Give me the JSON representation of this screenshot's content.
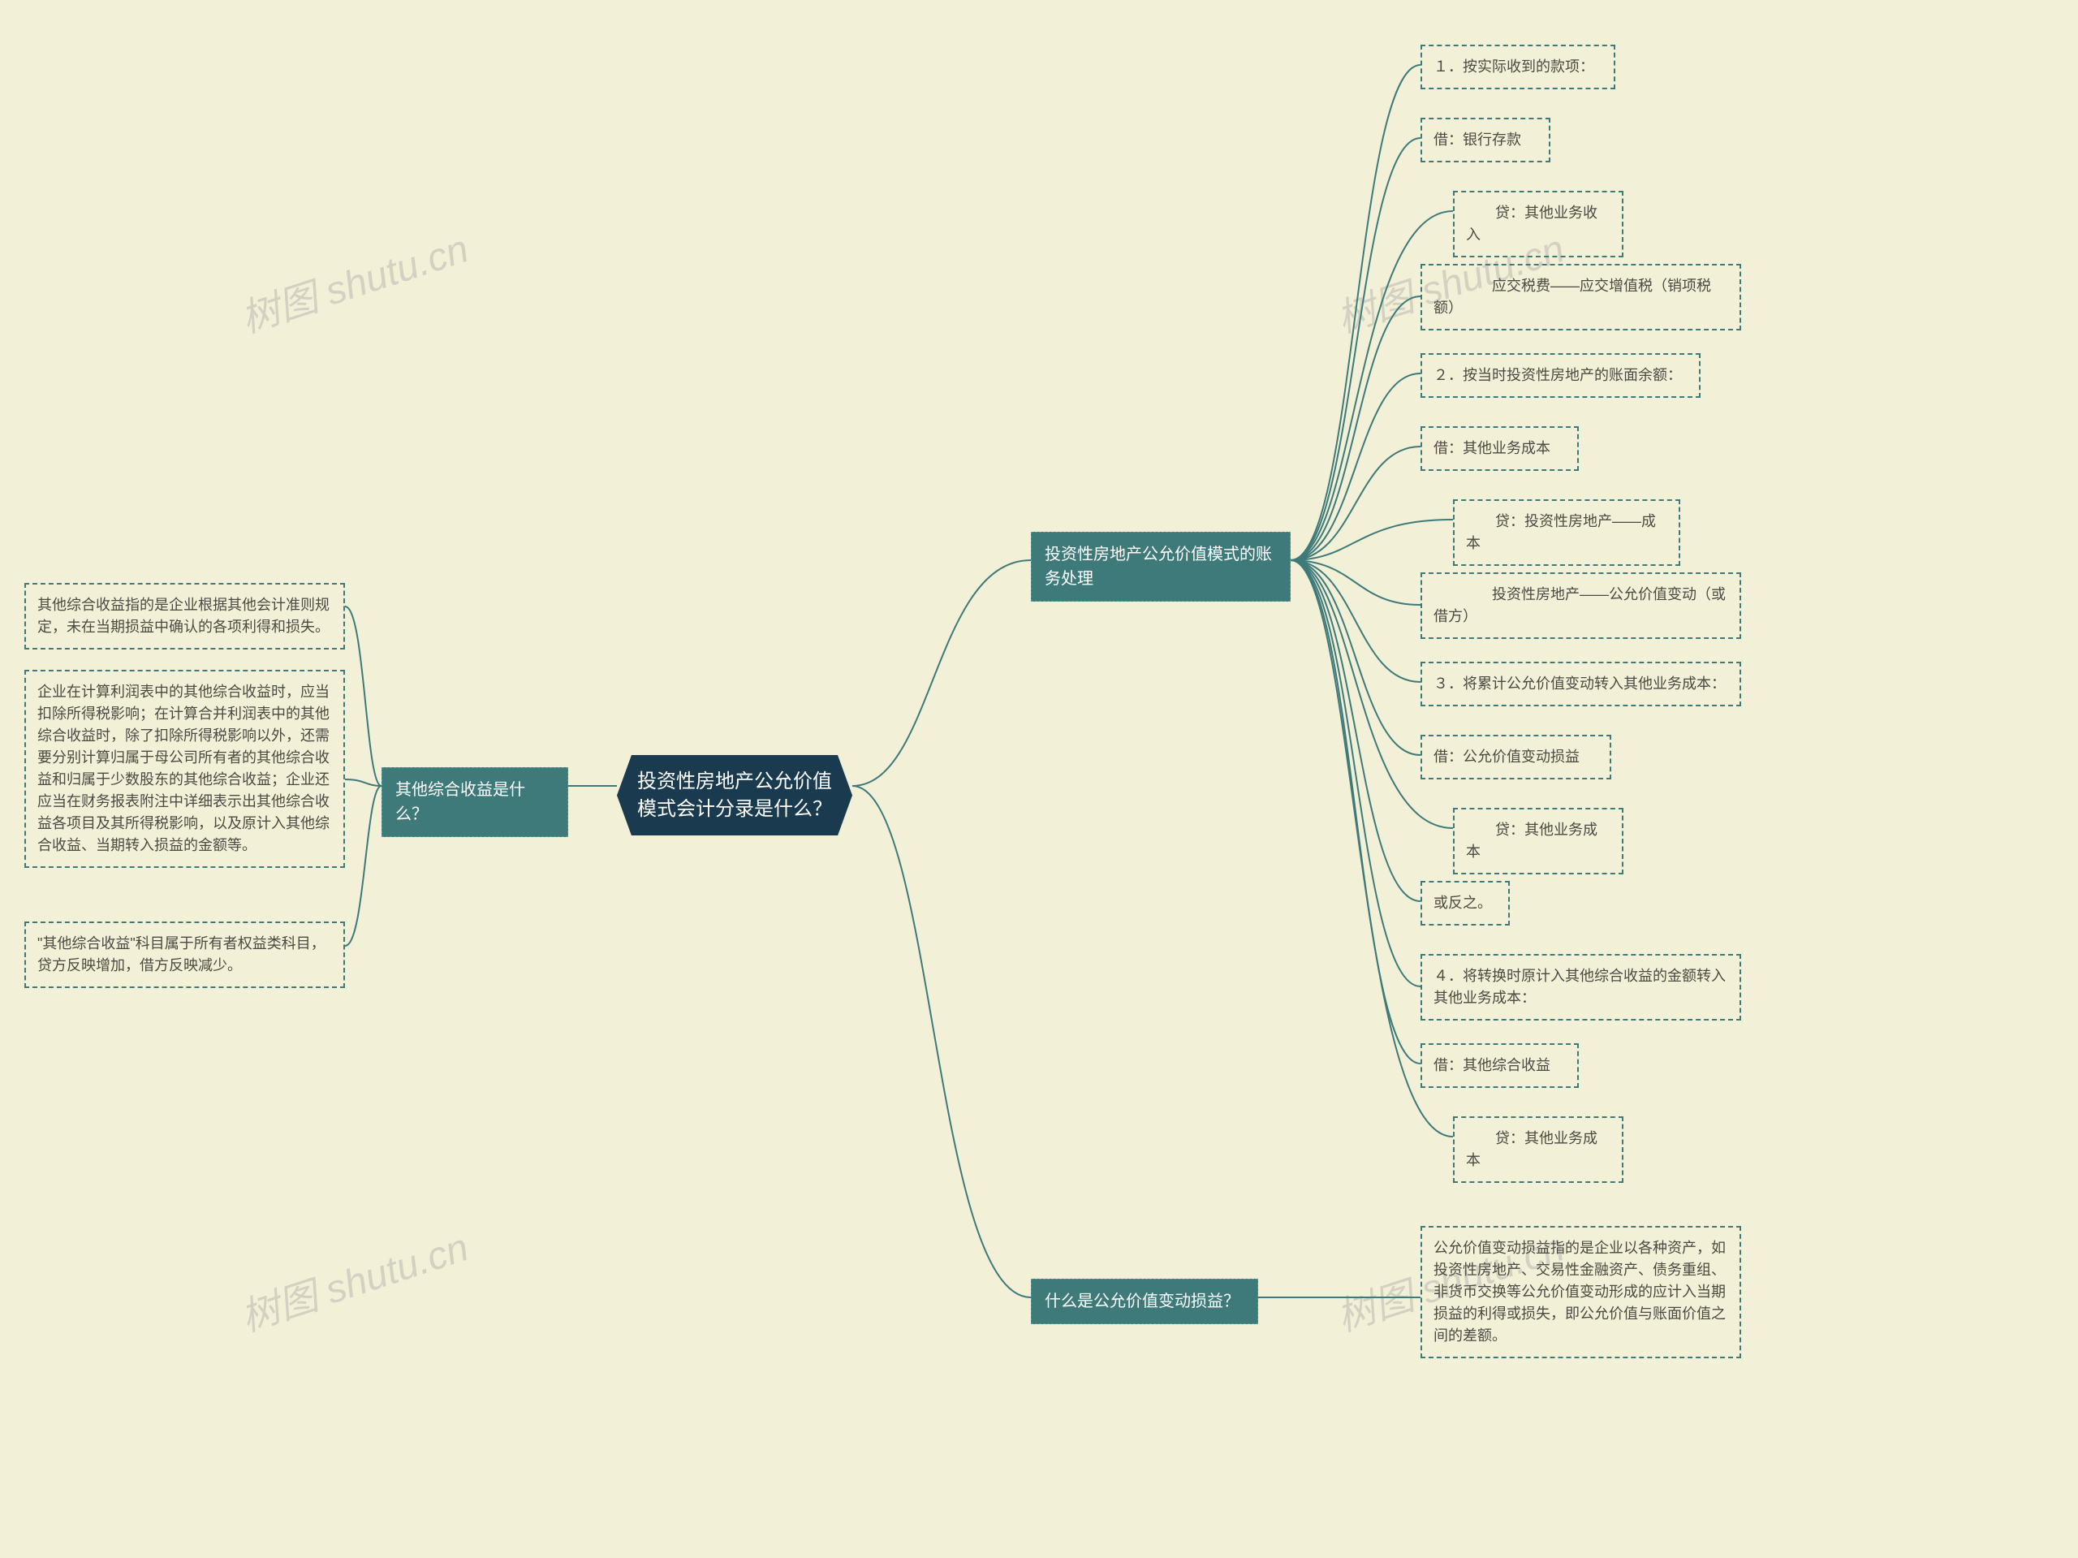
{
  "root": {
    "title": "投资性房地产公允价值模式会计分录是什么？"
  },
  "branches": {
    "left1": {
      "label": "其他综合收益是什么？",
      "leaves": [
        "其他综合收益指的是企业根据其他会计准则规定，未在当期损益中确认的各项利得和损失。",
        "企业在计算利润表中的其他综合收益时，应当扣除所得税影响；在计算合并利润表中的其他综合收益时，除了扣除所得税影响以外，还需要分别计算归属于母公司所有者的其他综合收益和归属于少数股东的其他综合收益；企业还应当在财务报表附注中详细表示出其他综合收益各项目及其所得税影响，以及原计入其他综合收益、当期转入损益的金额等。",
        "\"其他综合收益\"科目属于所有者权益类科目，贷方反映增加，借方反映减少。"
      ]
    },
    "right1": {
      "label": "投资性房地产公允价值模式的账务处理",
      "leaves": [
        "１．按实际收到的款项：",
        "借：银行存款",
        "　　贷：其他业务收入",
        "　　　　应交税费——应交增值税（销项税额）",
        "２．按当时投资性房地产的账面余额：",
        "借：其他业务成本",
        "　　贷：投资性房地产——成本",
        "　　　　投资性房地产——公允价值变动（或借方）",
        "３．将累计公允价值变动转入其他业务成本：",
        "借：公允价值变动损益",
        "　　贷：其他业务成本",
        "或反之。",
        "４．将转换时原计入其他综合收益的金额转入其他业务成本：",
        "借：其他综合收益",
        "　　贷：其他业务成本"
      ]
    },
    "right2": {
      "label": "什么是公允价值变动损益？",
      "leaves": [
        "公允价值变动损益指的是企业以各种资产，如投资性房地产、交易性金融资产、债务重组、非货币交换等公允价值变动形成的应计入当期损益的利得或损失，即公允价值与账面价值之间的差额。"
      ]
    }
  },
  "watermarks": [
    "树图 shutu.cn",
    "树图 shutu.cn",
    "树图 shutu.cn",
    "树图 shutu.cn"
  ]
}
